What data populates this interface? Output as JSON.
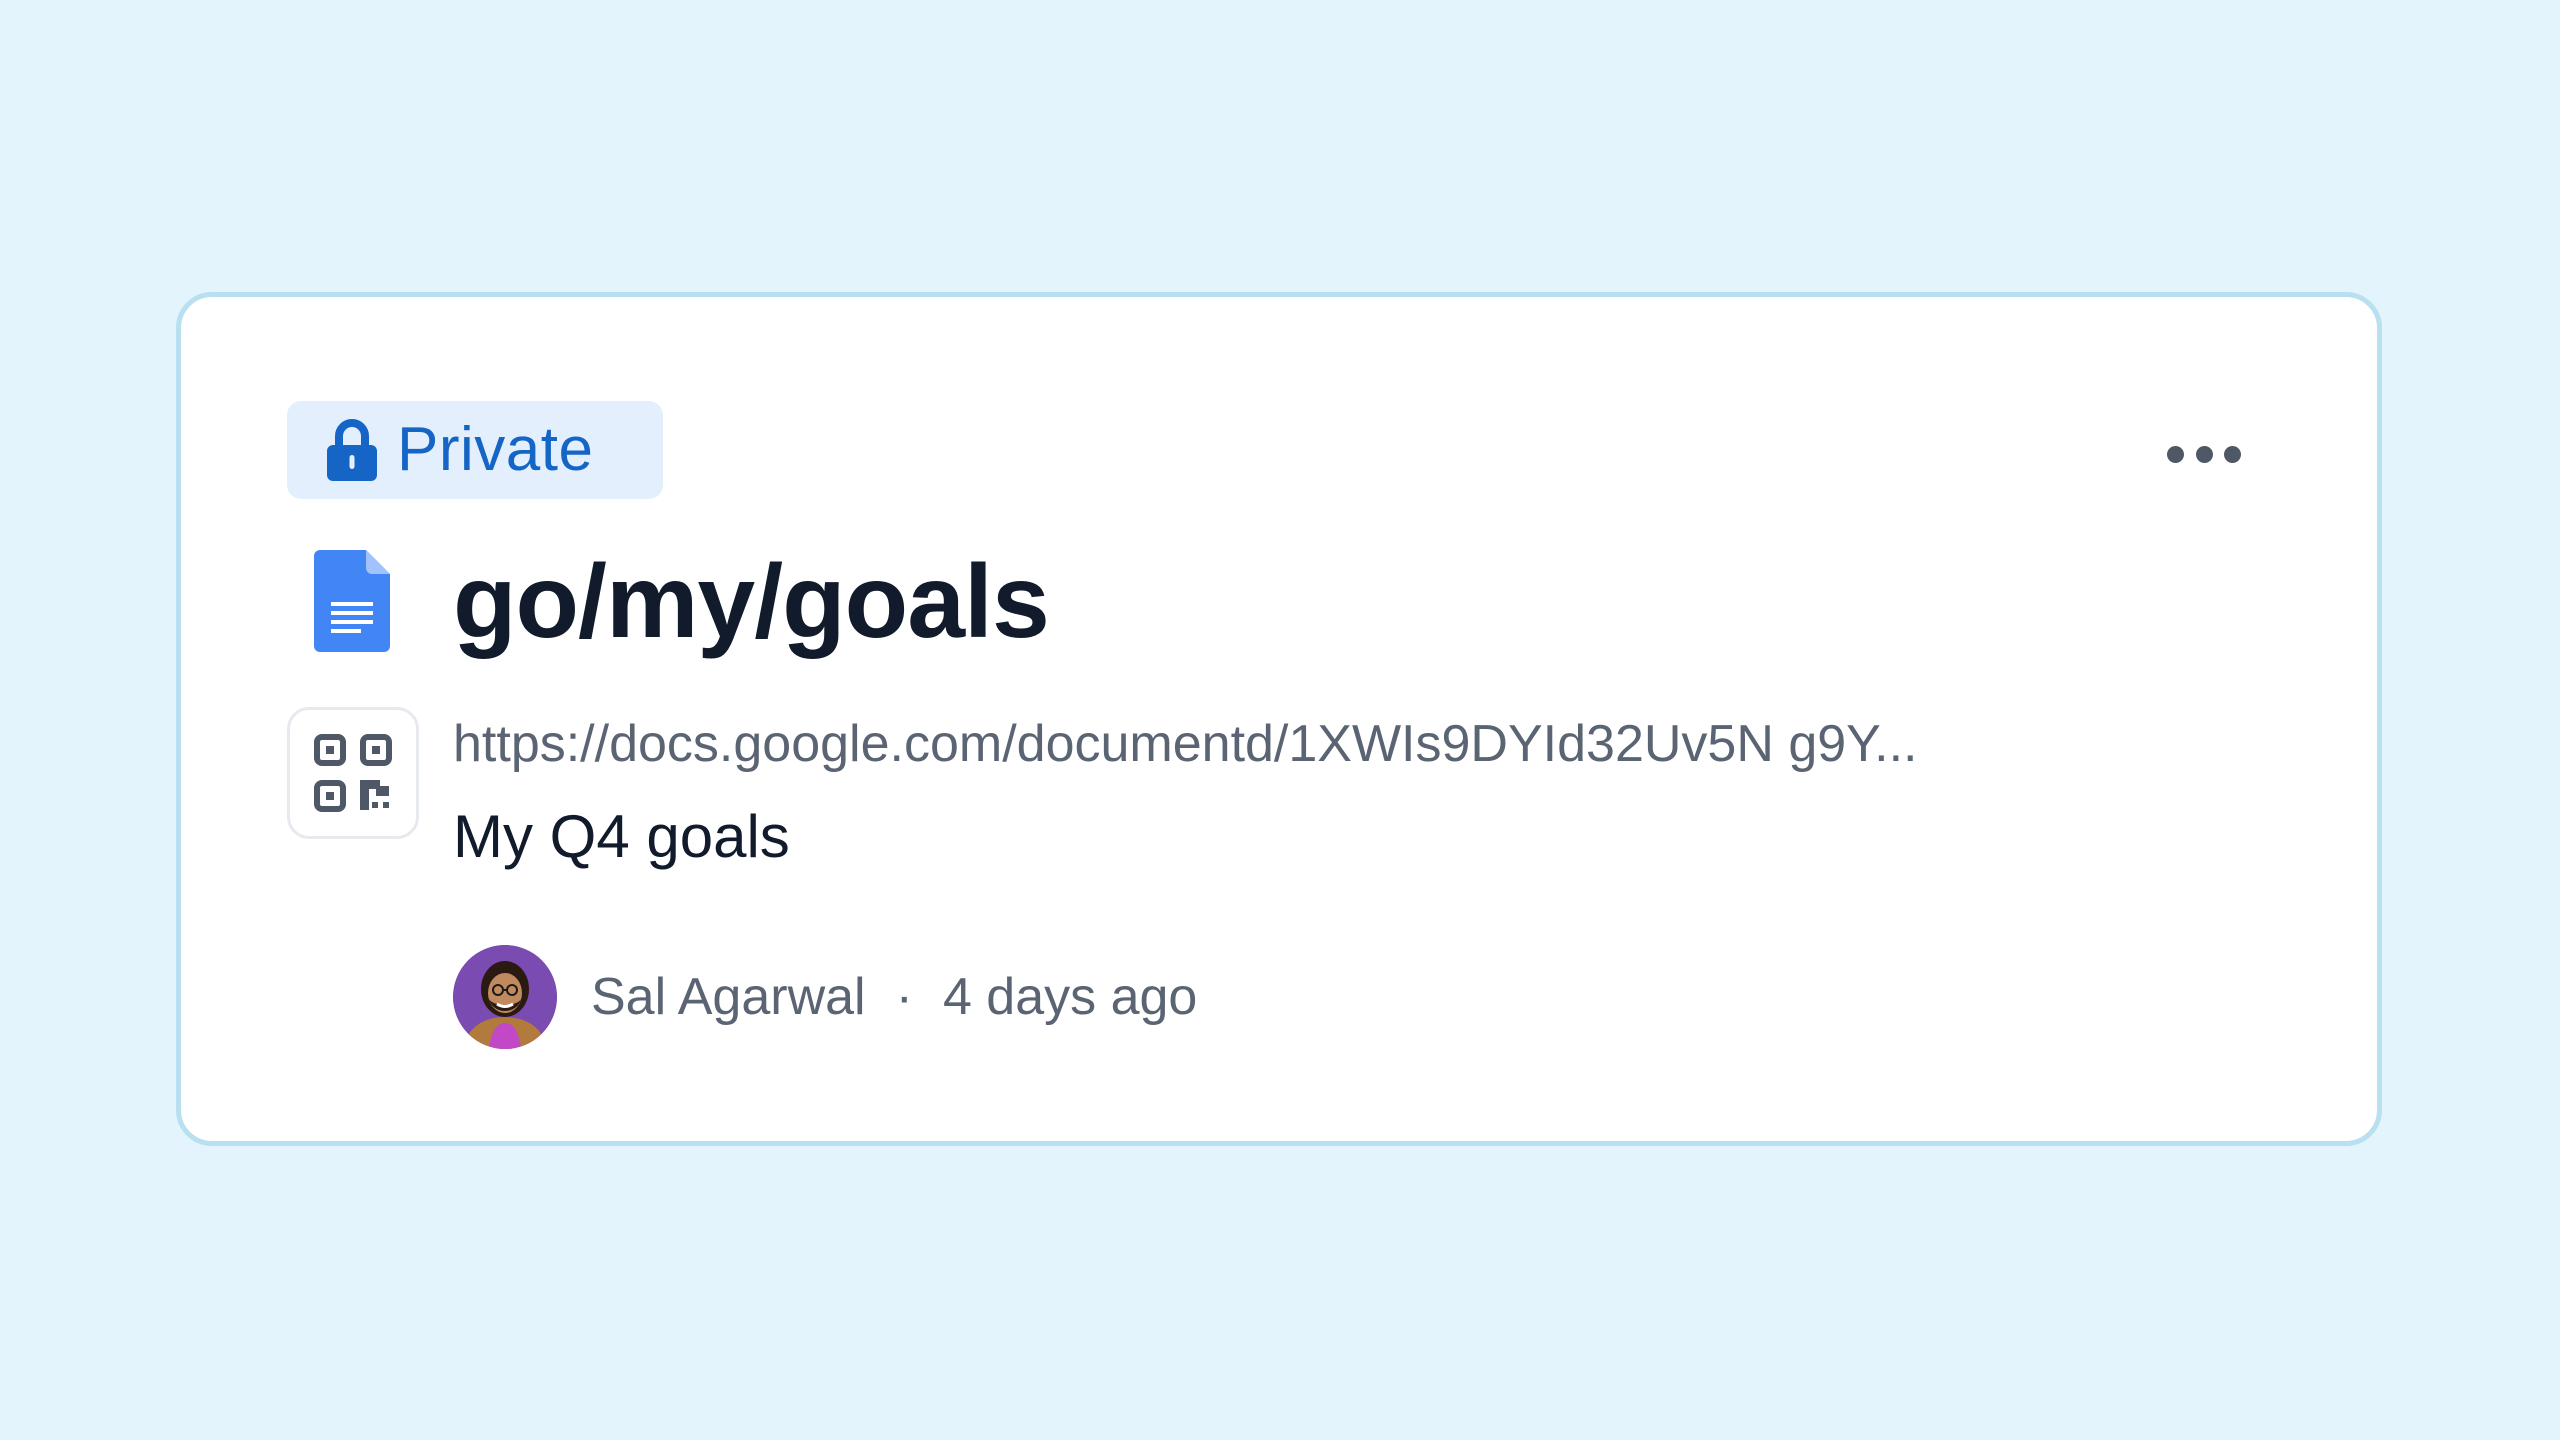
{
  "link_card": {
    "visibility_label": "Private",
    "visibility_icon": "lock-icon",
    "more_icon": "more-horizontal-icon",
    "doc_icon": "google-docs-icon",
    "qr_icon": "qr-code-icon",
    "title": "go/my/goals",
    "url": "https://docs.google.com/documentd/1XWIs9DYId32Uv5N g9Y...",
    "description": "My Q4 goals",
    "author": "Sal Agarwal",
    "separator": "·",
    "timestamp": "4 days ago"
  },
  "colors": {
    "page_background": "#e4f4fc",
    "card_border": "#b8e0f0",
    "badge_background": "#e3effc",
    "accent_blue": "#1565c7",
    "doc_blue": "#4285f4",
    "title_text": "#111b2b",
    "secondary_text": "#5a6472"
  }
}
